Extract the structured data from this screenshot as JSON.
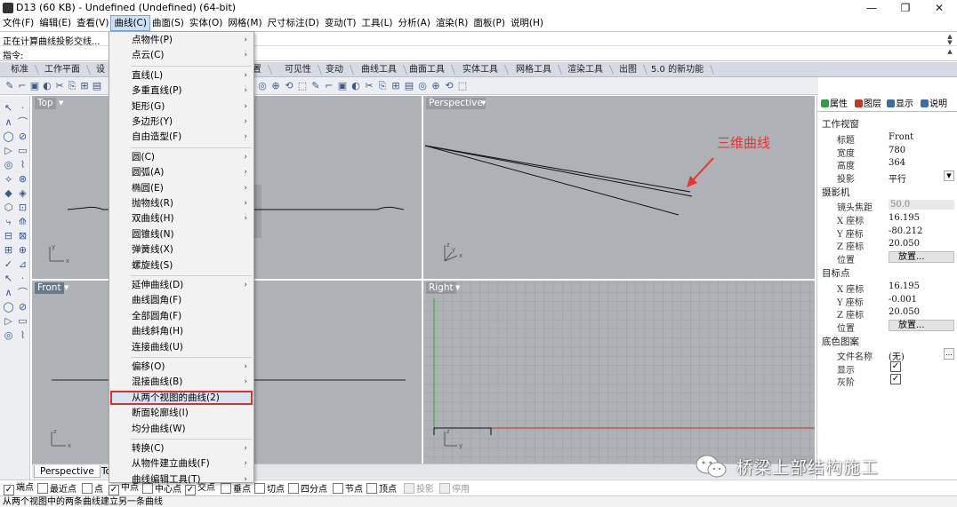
{
  "window": {
    "title": "D13 (60 KB) - Undefined (Undefined) (64-bit)",
    "minimize": "—",
    "restore": "❐",
    "close": "✕"
  },
  "menubar": [
    "文件(F)",
    "编辑(E)",
    "查看(V)",
    "曲线(C)",
    "曲面(S)",
    "实体(O)",
    "网格(M)",
    "尺寸标注(D)",
    "变动(T)",
    "工具(L)",
    "分析(A)",
    "渲染(R)",
    "面板(P)",
    "说明(H)"
  ],
  "menubar_active": "曲线(C)",
  "command": {
    "history": "正在计算曲线投影交线...",
    "prompt": "指令:"
  },
  "tabs": [
    "标准",
    "工作平面",
    "设",
    "置",
    "可见性",
    "变动",
    "曲线工具",
    "曲面工具",
    "实体工具",
    "网格工具",
    "渲染工具",
    "出图",
    "5.0 的新功能"
  ],
  "curve_menu": {
    "items": [
      {
        "label": "点物件(P)",
        "submenu": true
      },
      {
        "label": "点云(C)",
        "submenu": true
      },
      {
        "sep": true
      },
      {
        "label": "直线(L)",
        "submenu": true
      },
      {
        "label": "多重直线(P)",
        "submenu": true
      },
      {
        "label": "矩形(G)",
        "submenu": true
      },
      {
        "label": "多边形(Y)",
        "submenu": true
      },
      {
        "label": "自由造型(F)",
        "submenu": true
      },
      {
        "sep": true
      },
      {
        "label": "圆(C)",
        "submenu": true
      },
      {
        "label": "圆弧(A)",
        "submenu": true
      },
      {
        "label": "椭圆(E)",
        "submenu": true
      },
      {
        "label": "抛物线(R)",
        "submenu": true
      },
      {
        "label": "双曲线(H)",
        "submenu": true
      },
      {
        "label": "圆锥线(N)",
        "submenu": false
      },
      {
        "label": "弹簧线(X)",
        "submenu": false
      },
      {
        "label": "螺旋线(S)",
        "submenu": false
      },
      {
        "sep": true
      },
      {
        "label": "延伸曲线(D)",
        "submenu": true
      },
      {
        "label": "曲线圆角(F)",
        "submenu": false
      },
      {
        "label": "全部圆角(F)",
        "submenu": false
      },
      {
        "label": "曲线斜角(H)",
        "submenu": false
      },
      {
        "label": "连接曲线(U)",
        "submenu": false
      },
      {
        "sep": true
      },
      {
        "label": "偏移(O)",
        "submenu": true
      },
      {
        "label": "混接曲线(B)",
        "submenu": true
      },
      {
        "label": "从两个视图的曲线(2)",
        "submenu": false,
        "highlighted": true
      },
      {
        "label": "断面轮廓线(I)",
        "submenu": false
      },
      {
        "label": "均分曲线(W)",
        "submenu": false
      },
      {
        "sep": true
      },
      {
        "label": "转换(C)",
        "submenu": true
      },
      {
        "label": "从物件建立曲线(F)",
        "submenu": true
      },
      {
        "label": "曲线编辑工具(T)",
        "submenu": true
      }
    ]
  },
  "viewports": {
    "top": "Top",
    "perspective": "Perspective",
    "front": "Front",
    "right": "Right",
    "axis_x": "x",
    "axis_y": "y",
    "axis_z": "z"
  },
  "viewport_tabs": [
    "Perspective",
    "To"
  ],
  "annotation": "三维曲线",
  "properties": {
    "tabs": [
      "属性",
      "图层",
      "显示",
      "说明"
    ],
    "tab_colors": [
      "#2f9e44",
      "#c0392b",
      "#3a6ea5",
      "#3a6ea5"
    ],
    "section_viewport": "工作视窗",
    "title_label": "标题",
    "title_value": "Front",
    "width_label": "宽度",
    "width_value": "780",
    "height_label": "高度",
    "height_value": "364",
    "projection_label": "投影",
    "projection_value": "平行",
    "section_camera": "摄影机",
    "lens_label": "镜头焦距",
    "lens_value": "50.0",
    "cam_x_label": "X 座标",
    "cam_x_value": "16.195",
    "cam_y_label": "Y 座标",
    "cam_y_value": "-80.212",
    "cam_z_label": "Z 座标",
    "cam_z_value": "20.050",
    "cam_pos_label": "位置",
    "cam_pos_button": "放置...",
    "section_target": "目标点",
    "tgt_x_label": "X 座标",
    "tgt_x_value": "16.195",
    "tgt_y_label": "Y 座标",
    "tgt_y_value": "-0.001",
    "tgt_z_label": "Z 座标",
    "tgt_z_value": "20.050",
    "tgt_pos_label": "位置",
    "tgt_pos_button": "放置...",
    "section_wallpaper": "底色图案",
    "file_label": "文件名称",
    "file_value": "(无)",
    "show_label": "显示",
    "gray_label": "灰阶"
  },
  "osnaps": [
    {
      "label": "端点",
      "checked": true
    },
    {
      "label": "最近点",
      "checked": false
    },
    {
      "label": "点",
      "checked": false
    },
    {
      "label": "中点",
      "checked": true
    },
    {
      "label": "中心点",
      "checked": false
    },
    {
      "label": "交点",
      "checked": true
    },
    {
      "label": "垂点",
      "checked": false
    },
    {
      "label": "切点",
      "checked": false
    },
    {
      "label": "四分点",
      "checked": false
    },
    {
      "label": "节点",
      "checked": false
    },
    {
      "label": "顶点",
      "checked": false
    },
    {
      "label": "投影",
      "checked": false,
      "disabled": true
    },
    {
      "label": "停用",
      "checked": false,
      "disabled": true
    }
  ],
  "status": "从两个视图中的两条曲线建立另一条曲线",
  "watermark": "桥梁上部结构施工"
}
